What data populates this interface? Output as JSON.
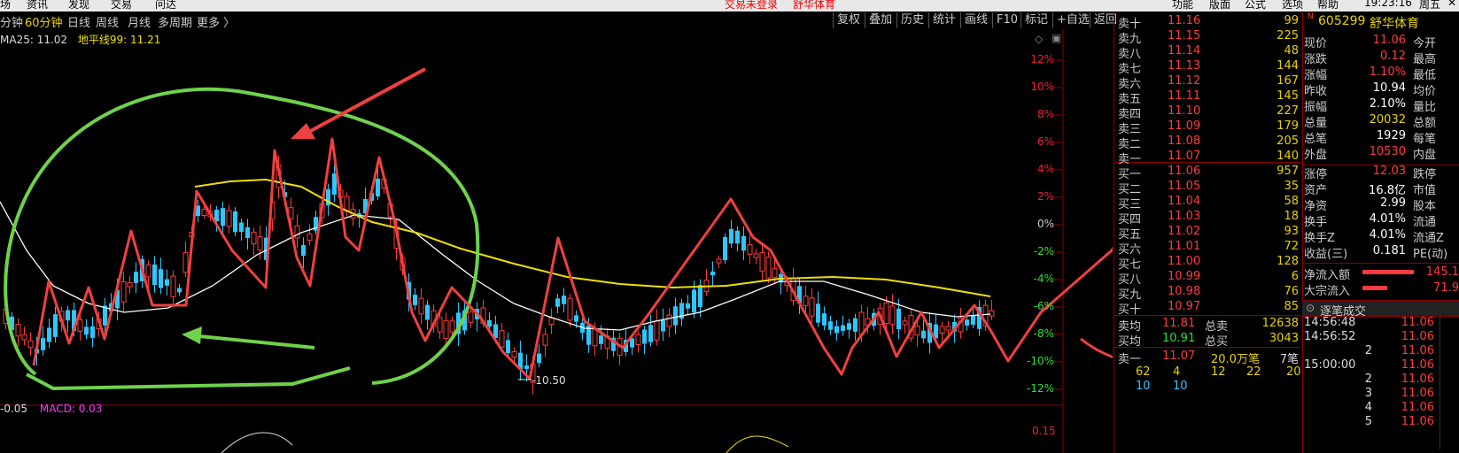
{
  "top_menu": {
    "items": [
      "场",
      "资讯",
      "发现",
      "交易",
      "问达"
    ],
    "center_notice": "交易未登录",
    "center_stock": "舒华体育",
    "right_items": [
      "功能",
      "版面",
      "公式",
      "选项",
      "帮助"
    ],
    "clock": "19:23:16",
    "weekday": "周五"
  },
  "periods": {
    "items": [
      "分钟",
      "60分钟",
      "日线",
      "周线",
      "月线",
      "多周期",
      "更多 〉"
    ],
    "active": "60分钟"
  },
  "toolbar": {
    "items": [
      "复权",
      "叠加",
      "历史",
      "统计",
      "画线",
      "F10",
      "标记",
      "+自选",
      "返回"
    ]
  },
  "indicator_line": {
    "ma25_label": "MA25: 11.02",
    "hline_label": "地平线99: 11.21"
  },
  "y_axis": {
    "labels": [
      "12%",
      "10%",
      "8%",
      "6%",
      "4%",
      "2%",
      "0%",
      "-2%",
      "-4%",
      "-6%",
      "-8%",
      "-10%",
      "-12%"
    ]
  },
  "low_marker": "-10.50",
  "bottom": {
    "left_value": "-0.05",
    "macd_label": "MACD: 0.03",
    "axis_value": "0.15"
  },
  "order_book": {
    "asks": [
      {
        "label": "卖十",
        "price": "11.16",
        "vol": "99"
      },
      {
        "label": "卖九",
        "price": "11.15",
        "vol": "225"
      },
      {
        "label": "卖八",
        "price": "11.14",
        "vol": "48"
      },
      {
        "label": "卖七",
        "price": "11.13",
        "vol": "144"
      },
      {
        "label": "卖六",
        "price": "11.12",
        "vol": "167"
      },
      {
        "label": "卖五",
        "price": "11.11",
        "vol": "145"
      },
      {
        "label": "卖四",
        "price": "11.10",
        "vol": "227"
      },
      {
        "label": "卖三",
        "price": "11.09",
        "vol": "179"
      },
      {
        "label": "卖二",
        "price": "11.08",
        "vol": "205"
      },
      {
        "label": "卖一",
        "price": "11.07",
        "vol": "140"
      }
    ],
    "bids": [
      {
        "label": "买一",
        "price": "11.06",
        "vol": "957"
      },
      {
        "label": "买二",
        "price": "11.05",
        "vol": "35"
      },
      {
        "label": "买三",
        "price": "11.04",
        "vol": "58"
      },
      {
        "label": "买四",
        "price": "11.03",
        "vol": "18"
      },
      {
        "label": "买五",
        "price": "11.02",
        "vol": "93"
      },
      {
        "label": "买六",
        "price": "11.01",
        "vol": "72"
      },
      {
        "label": "买七",
        "price": "11.00",
        "vol": "128"
      },
      {
        "label": "买八",
        "price": "10.99",
        "vol": "6"
      },
      {
        "label": "买九",
        "price": "10.98",
        "vol": "76"
      },
      {
        "label": "买十",
        "price": "10.97",
        "vol": "85"
      }
    ],
    "summary": {
      "sell_avg_label": "卖均",
      "sell_avg": "11.81",
      "sell_total_label": "总卖",
      "sell_total": "12638",
      "buy_avg_label": "买均",
      "buy_avg": "10.91",
      "buy_total_label": "总买",
      "buy_total": "3043"
    },
    "queue": {
      "label": "卖一",
      "price": "11.07",
      "qty": "20.0万笔",
      "count": "7笔",
      "row1": [
        "62",
        "4",
        "12",
        "22",
        "20"
      ],
      "row2": [
        "10",
        "10"
      ]
    }
  },
  "quote": {
    "badge": "N",
    "code": "605299",
    "name": "舒华体育",
    "rows": [
      {
        "l1": "现价",
        "v": "11.06",
        "l2": "今开",
        "color": "red"
      },
      {
        "l1": "涨跌",
        "v": "0.12",
        "l2": "最高",
        "color": "red"
      },
      {
        "l1": "涨幅",
        "v": "1.10%",
        "l2": "最低",
        "color": "red"
      },
      {
        "l1": "昨收",
        "v": "10.94",
        "l2": "均价",
        "color": "white"
      },
      {
        "l1": "振幅",
        "v": "2.10%",
        "l2": "量比",
        "color": "white"
      },
      {
        "l1": "总量",
        "v": "20032",
        "l2": "总额",
        "color": "yellow"
      },
      {
        "l1": "总笔",
        "v": "1929",
        "l2": "每笔",
        "color": "white"
      },
      {
        "l1": "外盘",
        "v": "10530",
        "l2": "内盘",
        "color": "red"
      },
      {
        "l1": "涨停",
        "v": "12.03",
        "l2": "跌停",
        "color": "red"
      },
      {
        "l1": "资产",
        "v": "16.8亿",
        "l2": "市值",
        "color": "white"
      },
      {
        "l1": "净资",
        "v": "2.99",
        "l2": "股本",
        "color": "white"
      },
      {
        "l1": "换手",
        "v": "4.01%",
        "l2": "流通",
        "color": "white"
      },
      {
        "l1": "换手Z",
        "v": "4.01%",
        "l2": "流通Z",
        "color": "white"
      },
      {
        "l1": "收益(三)",
        "v": "0.181",
        "l2": "PE(动)",
        "color": "white"
      }
    ],
    "flow": [
      {
        "label": "净流入额",
        "value": "145.1"
      },
      {
        "label": "大宗流入",
        "value": "71.9"
      }
    ]
  },
  "ticks": {
    "header": "逐笔成交",
    "rows": [
      {
        "time": "14:56:48",
        "price": "11.06"
      },
      {
        "time": "14:56:52",
        "price": "11.06"
      },
      {
        "time": "2",
        "price": "11.06"
      },
      {
        "time": "15:00:00",
        "price": "11.06"
      },
      {
        "time": "2",
        "price": "11.06"
      },
      {
        "time": "3",
        "price": "11.06"
      },
      {
        "time": "4",
        "price": "11.06"
      },
      {
        "time": "5",
        "price": "11.06"
      }
    ]
  },
  "colors": {
    "up": "#ff3b3b",
    "down": "#2cc7ff",
    "ma_white": "#ffffff",
    "ma_yellow": "#f0e000",
    "annot_green": "#6fd24a",
    "annot_red": "#f04040"
  }
}
